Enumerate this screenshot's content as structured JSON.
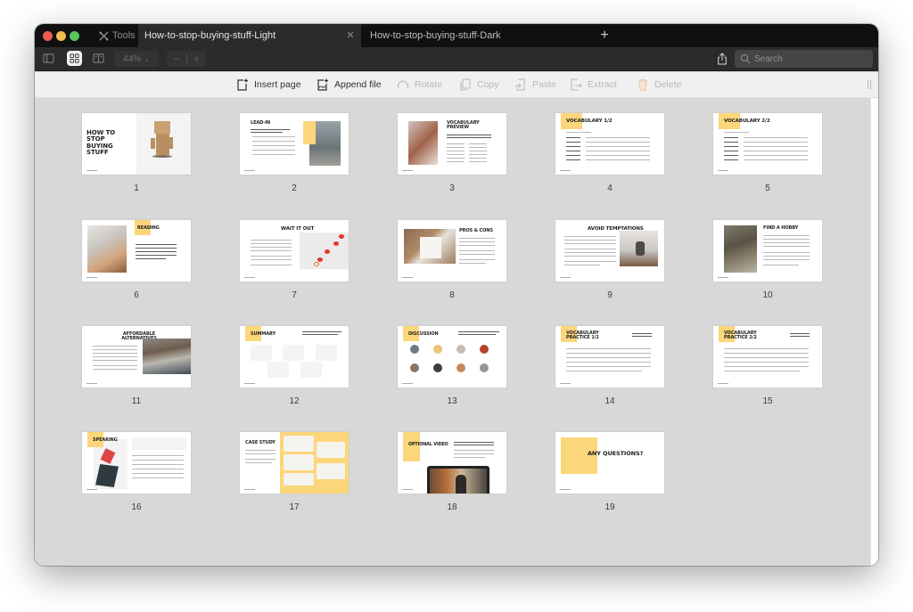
{
  "window": {
    "tools_label": "Tools",
    "tabs": [
      {
        "label": "How-to-stop-buying-stuff-Light",
        "active": true
      },
      {
        "label": "How-to-stop-buying-stuff-Dark",
        "active": false
      }
    ],
    "new_tab_icon": "plus-icon"
  },
  "toolbar": {
    "view_buttons": [
      {
        "icon": "sidebar-icon",
        "selected": false
      },
      {
        "icon": "grid-icon",
        "selected": true
      },
      {
        "icon": "two-page-icon",
        "selected": false
      }
    ],
    "zoom_level": "44%",
    "zoom_out": "−",
    "zoom_in": "+",
    "share_icon": "share-icon",
    "search_placeholder": "Search"
  },
  "page_actions": [
    {
      "label": "Insert page",
      "icon": "insert-page-icon",
      "enabled": true
    },
    {
      "label": "Append file",
      "icon": "append-pdf-icon",
      "enabled": true
    },
    {
      "label": "Rotate",
      "icon": "rotate-icon",
      "enabled": false
    },
    {
      "label": "Copy",
      "icon": "copy-icon",
      "enabled": false
    },
    {
      "label": "Paste",
      "icon": "paste-icon",
      "enabled": false
    },
    {
      "label": "Extract",
      "icon": "extract-icon",
      "enabled": false
    },
    {
      "label": "Delete",
      "icon": "trash-icon",
      "enabled": false
    }
  ],
  "accent_color": "#fcd67a",
  "pages": [
    {
      "number": "1",
      "title": "HOW TO STOP BUYING STUFF"
    },
    {
      "number": "2",
      "title": "LEAD-IN"
    },
    {
      "number": "3",
      "title": "VOCABULARY PREVIEW"
    },
    {
      "number": "4",
      "title": "VOCABULARY 1/2"
    },
    {
      "number": "5",
      "title": "VOCABULARY 2/2"
    },
    {
      "number": "6",
      "title": "READING"
    },
    {
      "number": "7",
      "title": "WAIT IT OUT"
    },
    {
      "number": "8",
      "title": "PROS & CONS"
    },
    {
      "number": "9",
      "title": "AVOID TEMPTATIONS"
    },
    {
      "number": "10",
      "title": "FIND A HOBBY"
    },
    {
      "number": "11",
      "title": "AFFORDABLE ALTERNATIVES"
    },
    {
      "number": "12",
      "title": "SUMMARY"
    },
    {
      "number": "13",
      "title": "DISCUSSION"
    },
    {
      "number": "14",
      "title": "VOCABULARY PRACTICE 1/2"
    },
    {
      "number": "15",
      "title": "VOCABULARY PRACTICE 2/2"
    },
    {
      "number": "16",
      "title": "SPEAKING"
    },
    {
      "number": "17",
      "title": "CASE STUDY"
    },
    {
      "number": "18",
      "title": "OPTIONAL VIDEO"
    },
    {
      "number": "19",
      "title": "ANY QUESTIONS?"
    }
  ]
}
